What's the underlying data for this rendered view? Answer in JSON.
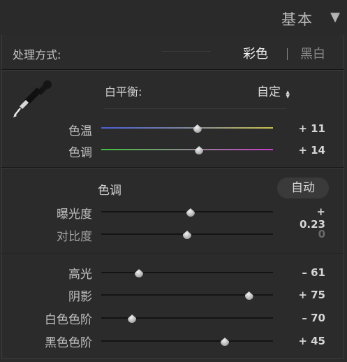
{
  "header": {
    "title": "基本",
    "collapse_icon": "triangle-down-icon"
  },
  "treatment": {
    "label": "处理方式:",
    "color_option": "彩色",
    "bw_option": "黑白",
    "selected": "彩色"
  },
  "white_balance": {
    "label": "白平衡:",
    "value": "自定",
    "eyedropper_icon": "eyedropper-icon",
    "stepper_icon": "up-down-arrows-icon"
  },
  "wb_sliders": [
    {
      "label": "色温",
      "value_text": "+ 11",
      "position": 0.56
    },
    {
      "label": "色调",
      "value_text": "+ 14",
      "position": 0.57
    }
  ],
  "tone": {
    "header": "色调",
    "auto_label": "自动",
    "sliders": [
      {
        "label": "曝光度",
        "value_text": "+ 0.23",
        "position": 0.52
      },
      {
        "label": "对比度",
        "value_text": "0",
        "position": 0.5
      }
    ]
  },
  "presence_sliders": [
    {
      "label": "高光",
      "value_text": "– 61",
      "position": 0.22
    },
    {
      "label": "阴影",
      "value_text": "+ 75",
      "position": 0.86
    },
    {
      "label": "白色色阶",
      "value_text": "– 70",
      "position": 0.18
    },
    {
      "label": "黑色色阶",
      "value_text": "+ 45",
      "position": 0.72
    }
  ]
}
